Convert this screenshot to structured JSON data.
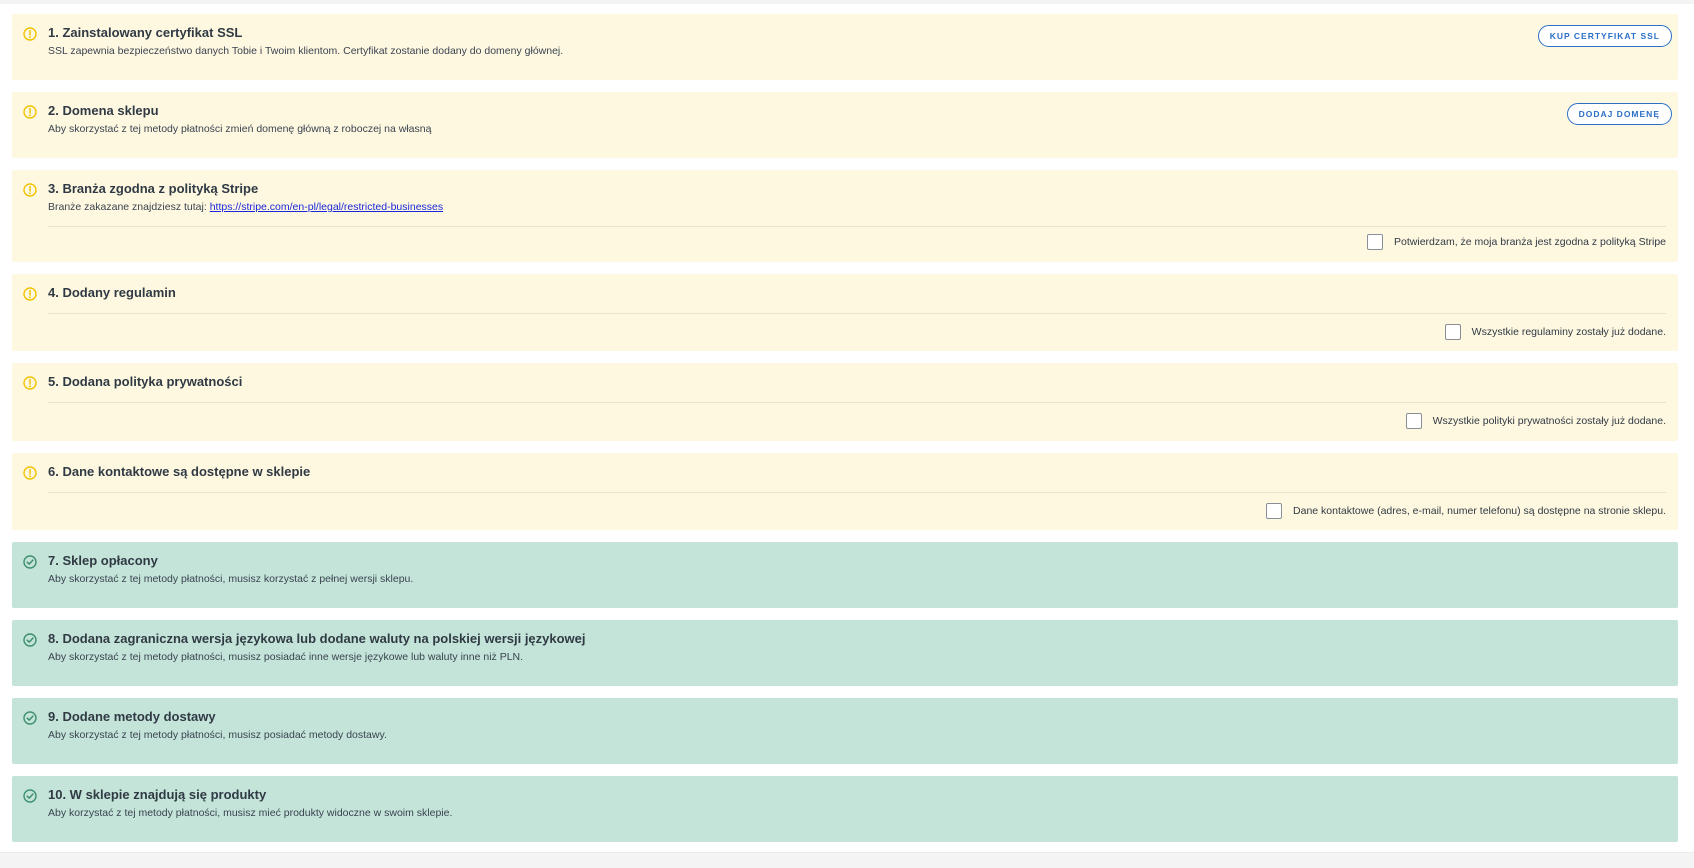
{
  "requirements": [
    {
      "title": "1. Zainstalowany certyfikat SSL",
      "description": "SSL zapewnia bezpieczeństwo danych Tobie i Twoim klientom. Certyfikat zostanie dodany do domeny głównej.",
      "status": "pending",
      "icon": "warning-circle-icon",
      "action_label": "KUP CERTYFIKAT SSL"
    },
    {
      "title": "2. Domena sklepu",
      "description": "Aby skorzystać z tej metody płatności zmień domenę główną z roboczej na własną",
      "status": "pending",
      "icon": "warning-circle-icon",
      "action_label": "DODAJ DOMENĘ"
    },
    {
      "title": "3. Branża zgodna z polityką Stripe",
      "description_prefix": "Branże zakazane znajdziesz tutaj:",
      "link_text": "https://stripe.com/en-pl/legal/restricted-businesses",
      "status": "pending",
      "icon": "warning-circle-icon",
      "confirm_label": "Potwierdzam, że moja branża jest zgodna z polityką Stripe",
      "checked": false
    },
    {
      "title": "4. Dodany regulamin",
      "status": "pending",
      "icon": "warning-circle-icon",
      "confirm_label": "Wszystkie regulaminy zostały już dodane.",
      "checked": false
    },
    {
      "title": "5. Dodana polityka prywatności",
      "status": "pending",
      "icon": "warning-circle-icon",
      "confirm_label": "Wszystkie polityki prywatności zostały już dodane.",
      "checked": false
    },
    {
      "title": "6. Dane kontaktowe są dostępne w sklepie",
      "status": "pending",
      "icon": "warning-circle-icon",
      "confirm_label": "Dane kontaktowe (adres, e-mail, numer telefonu) są dostępne na stronie sklepu.",
      "checked": false
    },
    {
      "title": "7. Sklep opłacony",
      "description": "Aby skorzystać z tej metody płatności, musisz korzystać z pełnej wersji sklepu.",
      "status": "done",
      "icon": "check-circle-icon"
    },
    {
      "title": "8. Dodana zagraniczna wersja językowa lub dodane waluty na polskiej wersji językowej",
      "description": "Aby skorzystać z tej metody płatności, musisz posiadać inne wersje językowe lub waluty inne niż PLN.",
      "status": "done",
      "icon": "check-circle-icon"
    },
    {
      "title": "9. Dodane metody dostawy",
      "description": "Aby skorzystać z tej metody płatności, musisz posiadać metody dostawy.",
      "status": "done",
      "icon": "check-circle-icon"
    },
    {
      "title": "10. W sklepie znajdują się produkty",
      "description": "Aby korzystać z tej metody płatności, musisz mieć produkty widoczne w swoim sklepie.",
      "status": "done",
      "icon": "check-circle-icon"
    }
  ],
  "colors": {
    "pending_bg": "#fef8e1",
    "done_bg": "#c4e4d9",
    "warning_icon": "#f2c200",
    "check_icon": "#3f8f6f",
    "button_accent": "#2b6fc6",
    "link": "#1a28d9"
  }
}
